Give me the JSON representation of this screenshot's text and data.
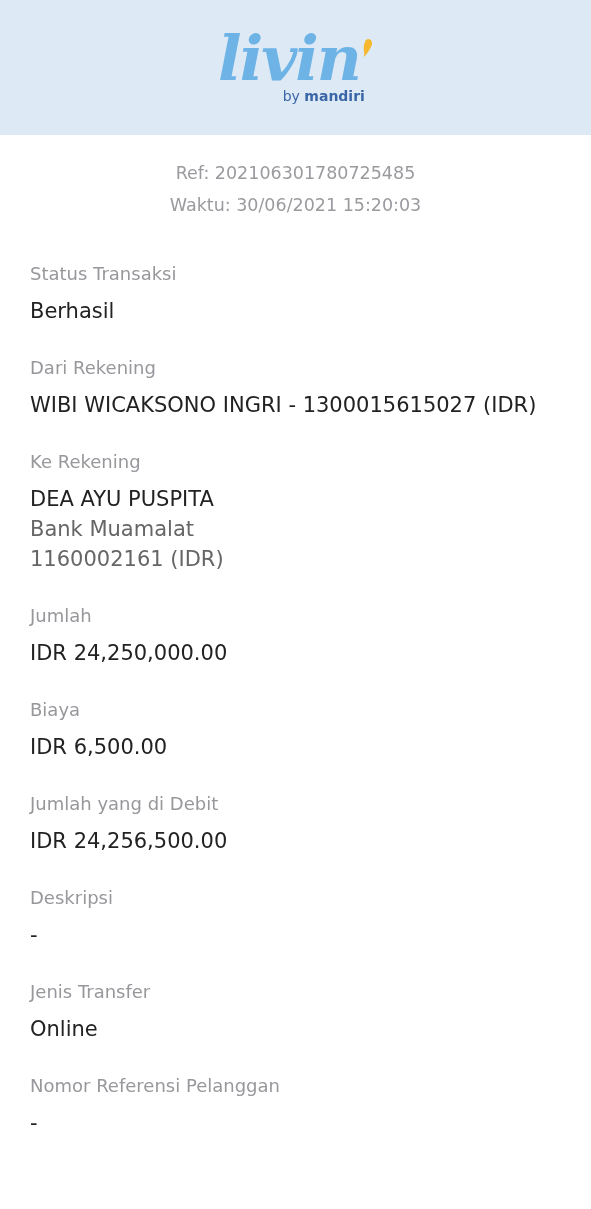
{
  "header": {
    "logo_wordmark": "livin",
    "logo_tagline": "by **mandiri**"
  },
  "receipt": {
    "reference": "Ref: 202106301780725485",
    "time": "Waktu: 30/06/2021 15:20:03"
  },
  "fields": [
    {
      "label": "Status Transaksi",
      "lines": [
        {
          "text": "Berhasil",
          "kind": "primary"
        }
      ]
    },
    {
      "label": "Dari Rekening",
      "lines": [
        {
          "text": "WIBI WICAKSONO INGRI - 1300015615027 (IDR)",
          "kind": "primary"
        }
      ]
    },
    {
      "label": "Ke Rekening",
      "lines": [
        {
          "text": "DEA AYU PUSPITA",
          "kind": "primary"
        },
        {
          "text": "Bank Muamalat",
          "kind": "secondary"
        },
        {
          "text": "1160002161 (IDR)",
          "kind": "secondary"
        }
      ]
    },
    {
      "label": "Jumlah",
      "lines": [
        {
          "text": "IDR 24,250,000.00",
          "kind": "primary"
        }
      ]
    },
    {
      "label": "Biaya",
      "lines": [
        {
          "text": "IDR 6,500.00",
          "kind": "primary"
        }
      ]
    },
    {
      "label": "Jumlah yang di Debit",
      "lines": [
        {
          "text": "IDR 24,256,500.00",
          "kind": "primary"
        }
      ]
    },
    {
      "label": "Deskripsi",
      "lines": [
        {
          "text": "-",
          "kind": "primary"
        }
      ]
    },
    {
      "label": "Jenis Transfer",
      "lines": [
        {
          "text": "Online",
          "kind": "primary"
        }
      ]
    },
    {
      "label": "Nomor Referensi Pelanggan",
      "lines": [
        {
          "text": "-",
          "kind": "primary"
        }
      ]
    }
  ]
}
